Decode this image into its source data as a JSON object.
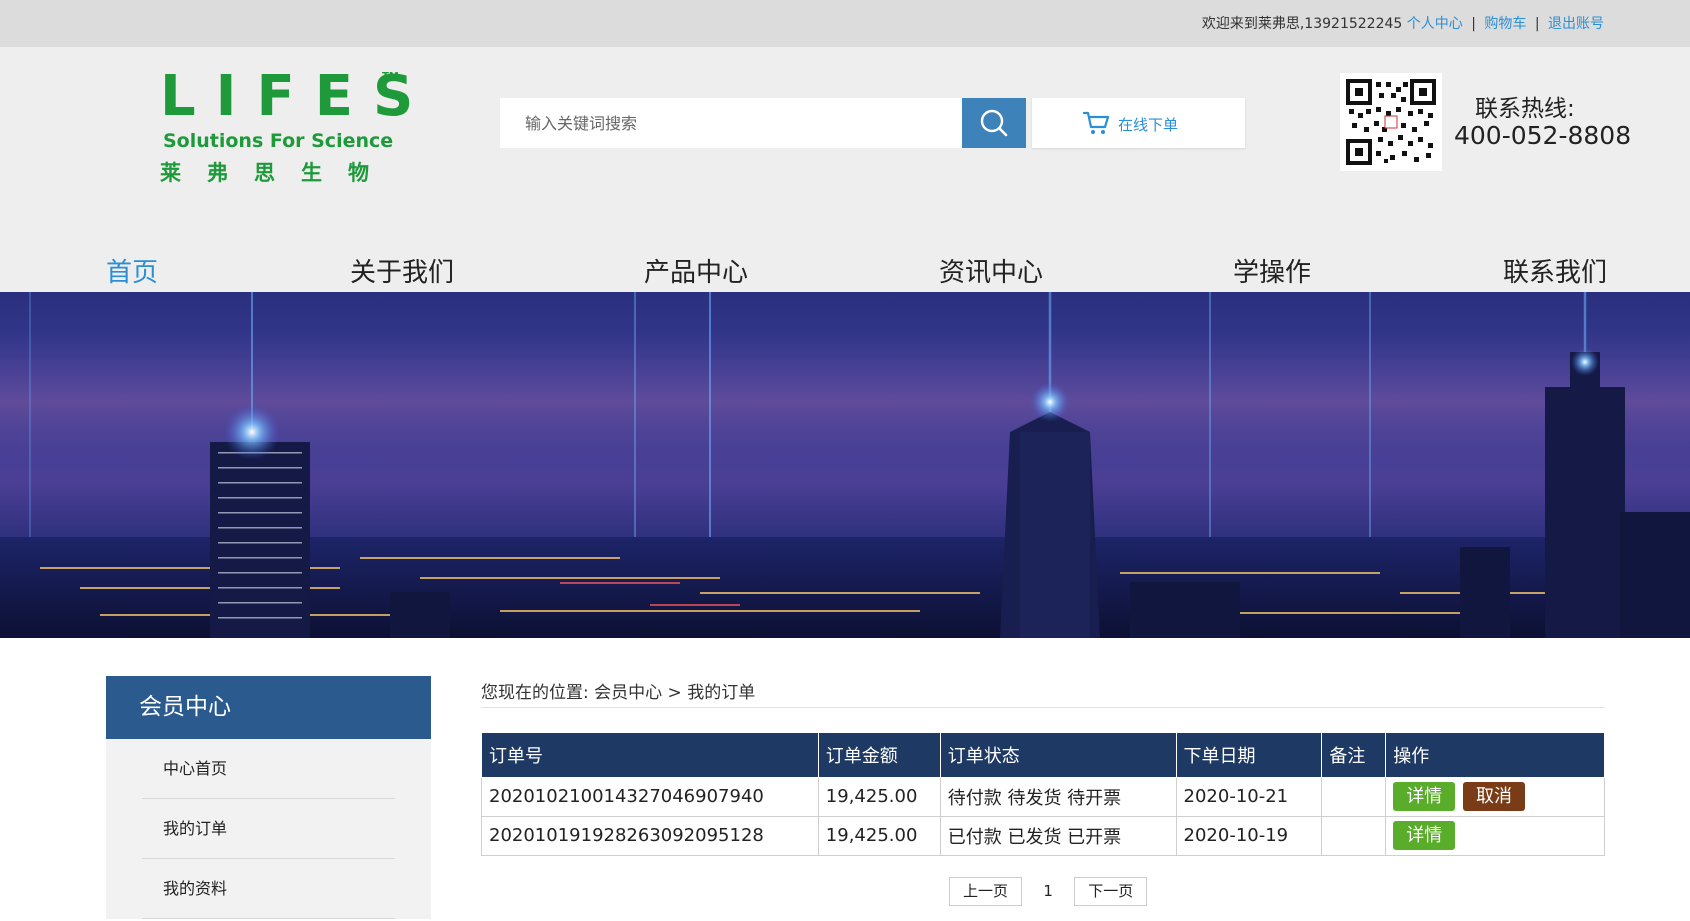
{
  "topbar": {
    "welcome": "欢迎来到莱弗思,13921522245",
    "links": [
      "个人中心",
      "购物车",
      "退出账号"
    ],
    "separator": "|"
  },
  "logo": {
    "word": "LIFES",
    "tm": "TM",
    "slogan": "Solutions For Science",
    "cn": "莱弗思生物"
  },
  "search": {
    "placeholder": "输入关键词搜索",
    "button_icon": "search-icon"
  },
  "order_button": {
    "label": "在线下单",
    "icon": "cart-icon"
  },
  "hotline": {
    "label": "联系热线:",
    "number": "400-052-8808"
  },
  "nav": {
    "items": [
      "首页",
      "关于我们",
      "产品中心",
      "资讯中心",
      "学操作",
      "联系我们"
    ],
    "active": "首页"
  },
  "sidebar": {
    "title": "会员中心",
    "items": [
      "中心首页",
      "我的订单",
      "我的资料"
    ]
  },
  "breadcrumb": {
    "prefix": "您现在的位置:",
    "crumb1": "会员中心",
    "separator": ">",
    "crumb2": "我的订单"
  },
  "orders": {
    "columns": [
      "订单号",
      "订单金额",
      "订单状态",
      "下单日期",
      "备注",
      "操作"
    ],
    "rows": [
      {
        "order_no": "20201021001432704690 7940",
        "amount": "19,425.00",
        "status": "待付款 待发货 待开票",
        "date": "2020-10-21",
        "note": "",
        "actions": [
          "详情",
          "取消"
        ]
      },
      {
        "order_no": "2020101919282630920 95128",
        "amount": "19,425.00",
        "status": "已付款 已发货 已开票",
        "date": "2020-10-19",
        "note": "",
        "actions": [
          "详情"
        ]
      }
    ]
  },
  "pagination": {
    "prev": "上一页",
    "current": "1",
    "next": "下一页"
  },
  "colors": {
    "brand_green": "#1f9a3b",
    "link_blue": "#2b8fd6",
    "table_header": "#1e3a64",
    "sidebar_header": "#2b5b8e",
    "detail_button": "#5aad2b",
    "cancel_button": "#7a3c16"
  }
}
